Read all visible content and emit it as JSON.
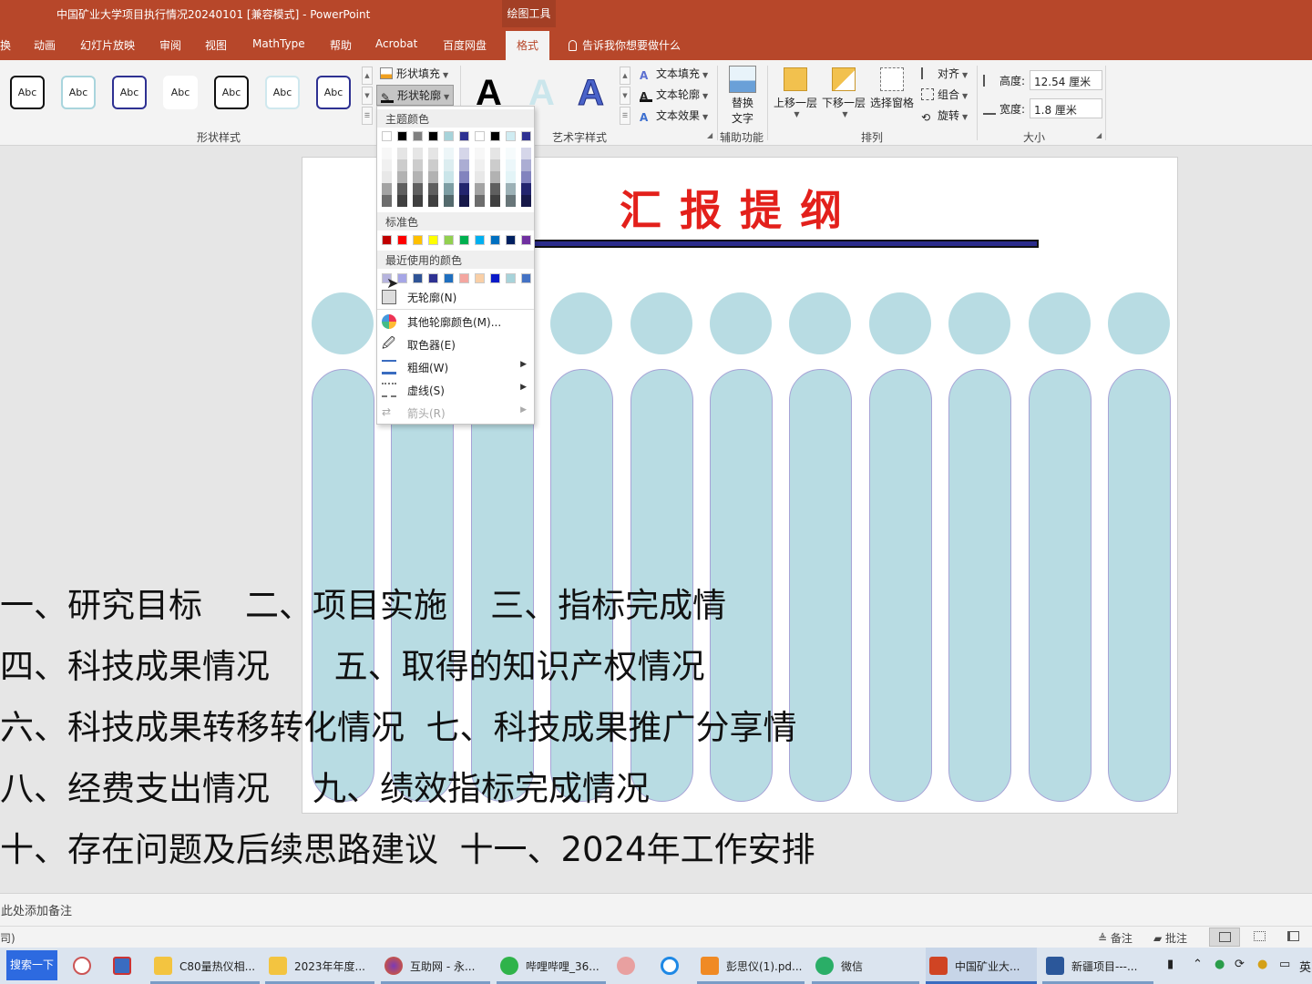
{
  "window": {
    "title": "中国矿业大学项目执行情况20240101 [兼容模式]  -  PowerPoint",
    "contextual_tab": "绘图工具"
  },
  "tabs": [
    "换",
    "动画",
    "幻灯片放映",
    "审阅",
    "视图",
    "MathType",
    "帮助",
    "Acrobat",
    "百度网盘"
  ],
  "active_tab": "格式",
  "tell_me": "告诉我你想要做什么",
  "ribbon": {
    "shape_styles": {
      "samples": [
        "Abc",
        "Abc",
        "Abc",
        "Abc",
        "Abc",
        "Abc",
        "Abc"
      ],
      "fill": "形状填充",
      "outline": "形状轮廓",
      "label": "形状样式"
    },
    "wordart": {
      "letter": "A",
      "text_fill": "文本填充",
      "text_outline": "文本轮廓",
      "text_effects": "文本效果",
      "label": "艺术字样式"
    },
    "accessibility": {
      "alt_text_line1": "替换",
      "alt_text_line2": "文字",
      "label": "辅助功能"
    },
    "arrange": {
      "bring_forward": "上移一层",
      "send_backward": "下移一层",
      "selection_pane": "选择窗格",
      "align": "对齐",
      "group": "组合",
      "rotate": "旋转",
      "label": "排列"
    },
    "size": {
      "height_label": "高度:",
      "height_value": "12.54 厘米",
      "width_label": "宽度:",
      "width_value": "1.8 厘米",
      "label": "大小"
    }
  },
  "dropdown": {
    "theme_colors_header": "主题颜色",
    "standard_colors_header": "标准色",
    "recent_colors_header": "最近使用的颜色",
    "theme_top_row": [
      "#ffffff",
      "#000000",
      "#808080",
      "#000000",
      "#a7d3da",
      "#2e3192",
      "#ffffff",
      "#000000",
      "#d0ecf2",
      "#2e3192"
    ],
    "standard_colors": [
      "#c00000",
      "#ff0000",
      "#ffc000",
      "#ffff00",
      "#92d050",
      "#00b050",
      "#00b0f0",
      "#0070c0",
      "#002060",
      "#7030a0"
    ],
    "recent_colors": [
      "#b6b4de",
      "#a6a6e6",
      "#2f5496",
      "#2e3192",
      "#1f6fbf",
      "#f4a6a0",
      "#f9cfa6",
      "#0a1ac8",
      "#a7d3da",
      "#4472c4"
    ],
    "items": {
      "no_outline": "无轮廓(N)",
      "more_colors": "其他轮廓颜色(M)...",
      "eyedropper": "取色器(E)",
      "weight": "粗细(W)",
      "dashes": "虚线(S)",
      "arrows": "箭头(R)"
    }
  },
  "slide": {
    "title": "汇报提纲",
    "shape_color": "#b8dce3",
    "outline_lines": [
      "一、研究目标    二、项目实施    三、指标完成情",
      "四、科技成果情况      五、取得的知识产权情况",
      "六、科技成果转移转化情况  七、科技成果推广分享情",
      "八、经费支出情况    九、绩效指标完成情况",
      "十、存在问题及后续思路建议  十一、2024年工作安排"
    ]
  },
  "notes_placeholder": "此处添加备注",
  "status": {
    "left": "司)",
    "notes_btn": "备注",
    "comments_btn": "批注"
  },
  "taskbar": {
    "search": "搜索一下",
    "items": [
      "C80量热仪相...",
      "2023年年度...",
      "互助网 - 永...",
      "哔哩哔哩_36...",
      "彭思仪(1).pd...",
      "微信",
      "中国矿业大...",
      "新疆项目---..."
    ],
    "ime": "英"
  }
}
